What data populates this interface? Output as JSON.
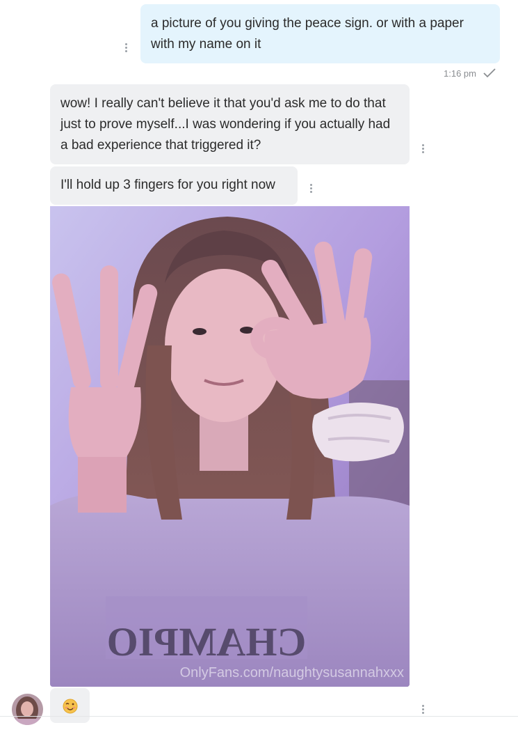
{
  "messages": {
    "outgoing": {
      "text": "a picture of you giving the peace sign. or with a paper with my name on it",
      "time": "1:16 pm"
    },
    "incoming_1": {
      "text": "wow! I really can't believe it that you'd ask me to do that just to prove myself...I was wondering if you actually had a bad experience that triggered it?"
    },
    "incoming_2": {
      "text": "I'll hold up 3 fingers for you right now"
    },
    "photo": {
      "watermark": "OnlyFans.com/naughtysusannahxxx",
      "shirt_text": "CHAMPIO"
    },
    "reaction": {
      "icon": "winking-face-emoji"
    }
  },
  "colors": {
    "outgoing_bubble": "#e4f4fd",
    "incoming_bubble": "#eff0f2",
    "timestamp": "#8a8d91"
  }
}
